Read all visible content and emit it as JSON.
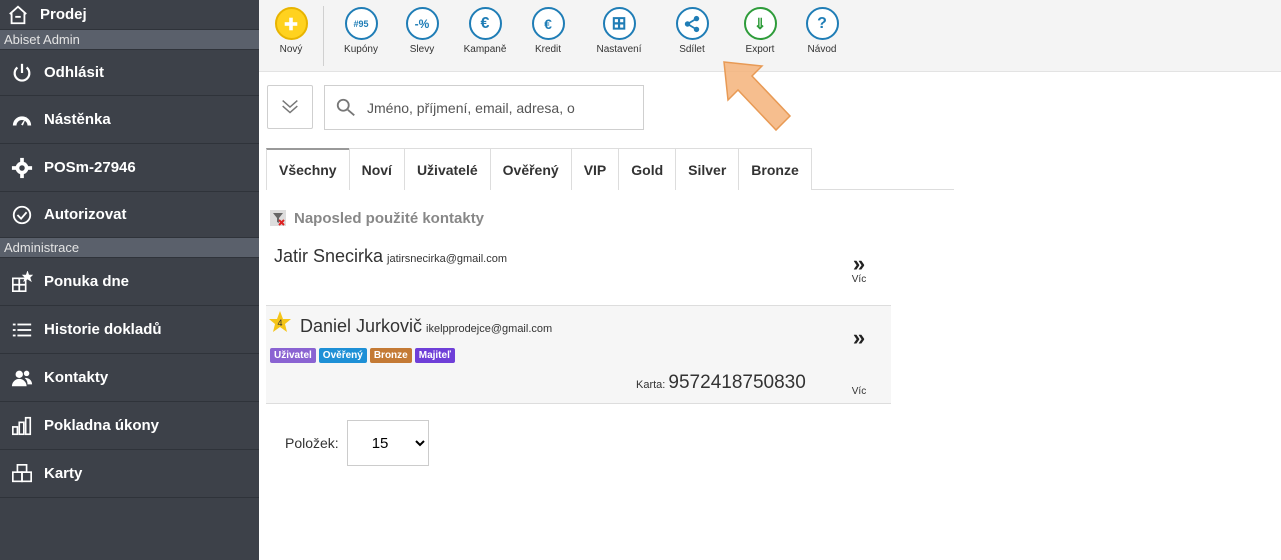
{
  "sidebar": {
    "items": [
      {
        "label": "Prodej",
        "icon": "home-icon"
      },
      {
        "section": "Abiset Admin"
      },
      {
        "label": "Odhlásit",
        "icon": "power-icon"
      },
      {
        "label": "Nástěnka",
        "icon": "dashboard-icon"
      },
      {
        "label": "POSm-27946",
        "icon": "gear-icon"
      },
      {
        "label": "Autorizovat",
        "icon": "check-circle-icon"
      },
      {
        "section": "Administrace"
      },
      {
        "label": "Ponuka dne",
        "icon": "grid-star-icon"
      },
      {
        "label": "Historie dokladů",
        "icon": "list-icon"
      },
      {
        "label": "Kontakty",
        "icon": "users-icon"
      },
      {
        "label": "Pokladna úkony",
        "icon": "bars-icon"
      },
      {
        "label": "Karty",
        "icon": "grid-icon"
      }
    ]
  },
  "toolbar": {
    "buttons": [
      {
        "label": "Nový",
        "icon": "plus-icon",
        "glyph": "+"
      },
      {
        "label": "Kupóny",
        "icon": "coupon-icon",
        "glyph": "#95"
      },
      {
        "label": "Slevy",
        "icon": "percent-icon",
        "glyph": "-%"
      },
      {
        "label": "Kampaně",
        "icon": "euro-arrow-icon",
        "glyph": "€"
      },
      {
        "label": "Kredit",
        "icon": "credit-icon",
        "glyph": "€"
      },
      {
        "label": "Nastavení",
        "icon": "settings-grid-icon",
        "glyph": "⊞"
      },
      {
        "label": "Sdílet",
        "icon": "share-icon",
        "glyph": "<"
      },
      {
        "label": "Export",
        "icon": "export-icon",
        "glyph": "⇓"
      },
      {
        "label": "Návod",
        "icon": "help-icon",
        "glyph": "?"
      }
    ]
  },
  "search": {
    "placeholder": "Jméno, příjmení, email, adresa, o"
  },
  "tabs": [
    "Všechny",
    "Noví",
    "Uživatelé",
    "Ověřený",
    "VIP",
    "Gold",
    "Silver",
    "Bronze"
  ],
  "recent": {
    "title": "Naposled použité kontakty"
  },
  "contacts": [
    {
      "name": "Jatir Snecirka",
      "email": "jatirsnecirka@gmail.com",
      "more_label": "Víc"
    },
    {
      "name": "Daniel Jurkovič",
      "email": "ikelpprodejce@gmail.com",
      "star_number": "4",
      "badges": [
        {
          "label": "Uživatel",
          "color": "#8a63d2"
        },
        {
          "label": "Ověřený",
          "color": "#1e90d6"
        },
        {
          "label": "Bronze",
          "color": "#c47a35"
        },
        {
          "label": "Majiteľ",
          "color": "#6f3fd8"
        }
      ],
      "card_label": "Karta:",
      "card_number": "9572418750830",
      "more_label": "Víc"
    }
  ],
  "pagination": {
    "label": "Položek:",
    "selected": "15"
  },
  "colors": {
    "sidebar_bg": "#3d4149",
    "accent": "#1f7db6",
    "arrow": "#f5b37a"
  }
}
